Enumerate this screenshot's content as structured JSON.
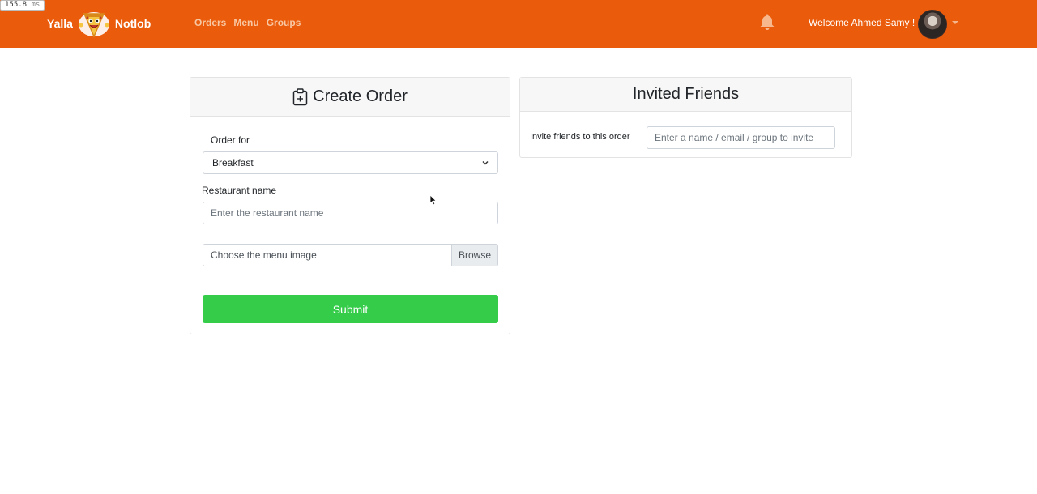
{
  "perf": {
    "value": "155.8",
    "unit": "ms"
  },
  "navbar": {
    "brand_left": "Yalla",
    "brand_right": "Notlob",
    "links": [
      "Orders",
      "Menu",
      "Groups"
    ],
    "welcome": "Welcome Ahmed Samy !",
    "colors": {
      "background": "#ea5c0c",
      "link": "#f8c7a3"
    }
  },
  "create_order": {
    "title": "Create Order",
    "order_for_label": "Order for",
    "order_for_value": "Breakfast",
    "restaurant_label": "Restaurant name",
    "restaurant_placeholder": "Enter the restaurant name",
    "menu_image_label": "Choose the menu image",
    "browse_label": "Browse",
    "submit_label": "Submit",
    "submit_color": "#35cc4a"
  },
  "invited_friends": {
    "title": "Invited Friends",
    "invite_label": "Invite friends to this order",
    "invite_placeholder": "Enter a name / email / group to invite"
  },
  "icons": [
    "pizza-mascot-logo",
    "bell-icon",
    "avatar",
    "chevron-down-icon",
    "clipboard-plus-icon",
    "mouse-cursor"
  ]
}
